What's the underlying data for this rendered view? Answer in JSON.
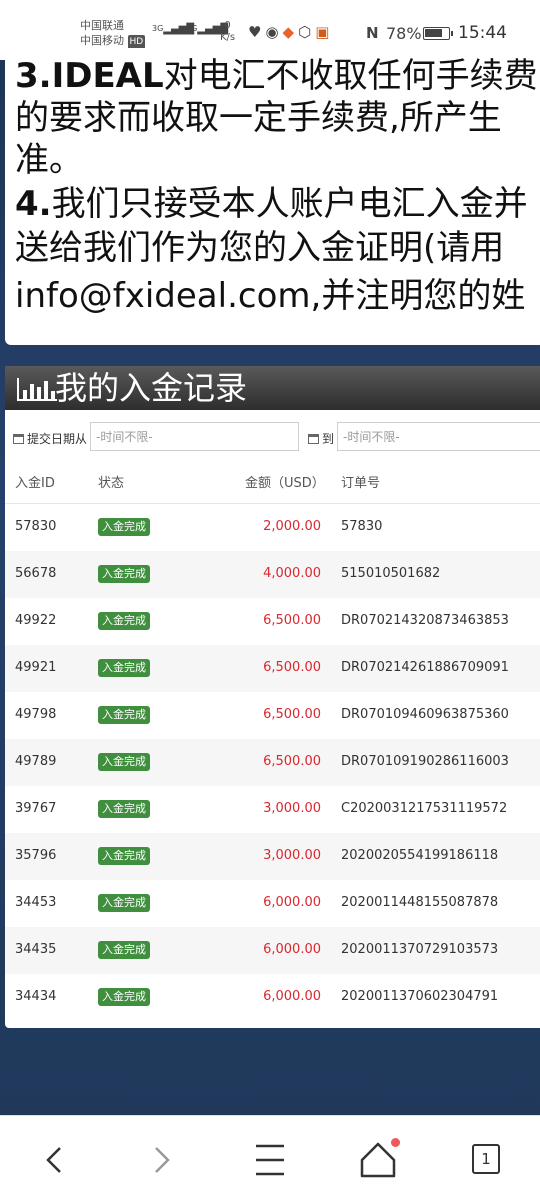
{
  "status_bar": {
    "carrier_1": "中国联通",
    "carrier_2": "中国移动",
    "hd": "HD",
    "net_1": "3G",
    "net_2": "5G",
    "speed_value": "0",
    "speed_unit": "K/s",
    "battery": "78%",
    "battery_level": 0.78,
    "time": "15:44"
  },
  "notice": {
    "line1_num": "3.IDEAL",
    "line1_text": "对电汇不收取任何手续费",
    "line2": "的要求而收取一定手续费,所产生",
    "line3": "准。",
    "line4_num": "4.",
    "line4_text": "我们只接受本人账户电汇入金并",
    "line5": "送给我们作为您的入金证明(请用",
    "line6": "info@fxideal.com,并注明您的姓"
  },
  "records": {
    "title": "我的入金记录",
    "filter_from_label": "提交日期从",
    "filter_from_placeholder": "-时间不限-",
    "filter_to_label": "到",
    "filter_to_placeholder": "-时间不限-",
    "columns": [
      "入金ID",
      "状态",
      "金额（USD）",
      "订单号"
    ],
    "rows": [
      {
        "id": "57830",
        "status": "入金完成",
        "amount": "2,000.00",
        "order": "57830"
      },
      {
        "id": "56678",
        "status": "入金完成",
        "amount": "4,000.00",
        "order": "515010501682"
      },
      {
        "id": "49922",
        "status": "入金完成",
        "amount": "6,500.00",
        "order": "DR070214320873463853"
      },
      {
        "id": "49921",
        "status": "入金完成",
        "amount": "6,500.00",
        "order": "DR070214261886709091"
      },
      {
        "id": "49798",
        "status": "入金完成",
        "amount": "6,500.00",
        "order": "DR070109460963875360"
      },
      {
        "id": "49789",
        "status": "入金完成",
        "amount": "6,500.00",
        "order": "DR070109190286116003"
      },
      {
        "id": "39767",
        "status": "入金完成",
        "amount": "3,000.00",
        "order": "C2020031217531119572"
      },
      {
        "id": "35796",
        "status": "入金完成",
        "amount": "3,000.00",
        "order": "2020020554199186118"
      },
      {
        "id": "34453",
        "status": "入金完成",
        "amount": "6,000.00",
        "order": "2020011448155087878"
      },
      {
        "id": "34435",
        "status": "入金完成",
        "amount": "6,000.00",
        "order": "2020011370729103573"
      },
      {
        "id": "34434",
        "status": "入金完成",
        "amount": "6,000.00",
        "order": "2020011370602304791"
      }
    ]
  },
  "bottom_nav": {
    "tab_count": "1",
    "icons": [
      "back-icon",
      "forward-icon",
      "menu-icon",
      "home-icon",
      "tabs-icon"
    ]
  },
  "colors": {
    "amount_red": "#d9282f",
    "badge_green": "#3f8f3f",
    "header_dark": "#3a3a3a"
  }
}
